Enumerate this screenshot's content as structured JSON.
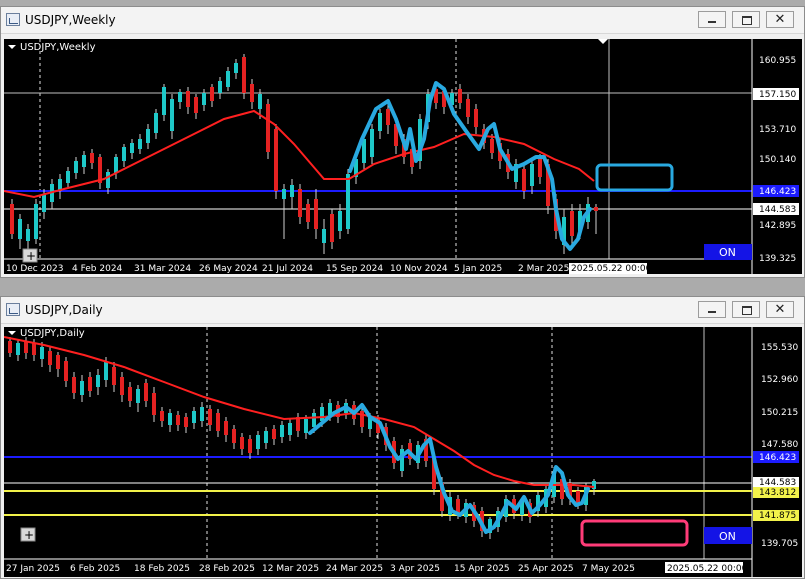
{
  "windows": [
    {
      "title": "USDJPY,Weekly",
      "chart_label": "USDJPY,Weekly",
      "price_labels": [
        "160.955",
        "157.150",
        "153.710",
        "150.140",
        "146.423",
        "144.583",
        "142.895",
        "139.325"
      ],
      "date_labels": [
        "10 Dec 2023",
        "4 Feb 2024",
        "31 Mar 2024",
        "26 May 2024",
        "21 Jul 2024",
        "15 Sep 2024",
        "10 Nov 2024",
        "5 Jan 2025",
        "2 Mar 2025"
      ],
      "cursor_date": "2025.05.22 00:00",
      "on_label": "ON",
      "colors": {
        "ma": "#ff2020",
        "hline_blue": "#1c1cff",
        "bull": "#1ec8c8",
        "bear": "#e52222",
        "hand_drawn": "#29a9e0",
        "box": "#29a9e0"
      }
    },
    {
      "title": "USDJPY,Daily",
      "chart_label": "USDJPY,Daily",
      "price_labels": [
        "155.530",
        "152.960",
        "150.215",
        "147.580",
        "146.423",
        "144.583",
        "143.812",
        "141.875",
        "139.705"
      ],
      "date_labels": [
        "27 Jan 2025",
        "6 Feb 2025",
        "18 Feb 2025",
        "28 Feb 2025",
        "12 Mar 2025",
        "24 Mar 2025",
        "3 Apr 2025",
        "15 Apr 2025",
        "25 Apr 2025",
        "7 May 2025"
      ],
      "cursor_date": "2025.05.22 00:00",
      "on_label": "ON",
      "colors": {
        "ma": "#ff2020",
        "hline_blue": "#1c1cff",
        "hline_yellow": "#f2f24a",
        "bull": "#1ec8c8",
        "bear": "#e52222",
        "hand_drawn": "#29a9e0",
        "box": "#ff3c78"
      }
    }
  ],
  "icons": {
    "minimize": "minimize-icon",
    "maximize": "maximize-icon",
    "close": "close-icon",
    "app": "chart-window-icon"
  },
  "close_glyph": "✕",
  "plus_glyph": "+"
}
